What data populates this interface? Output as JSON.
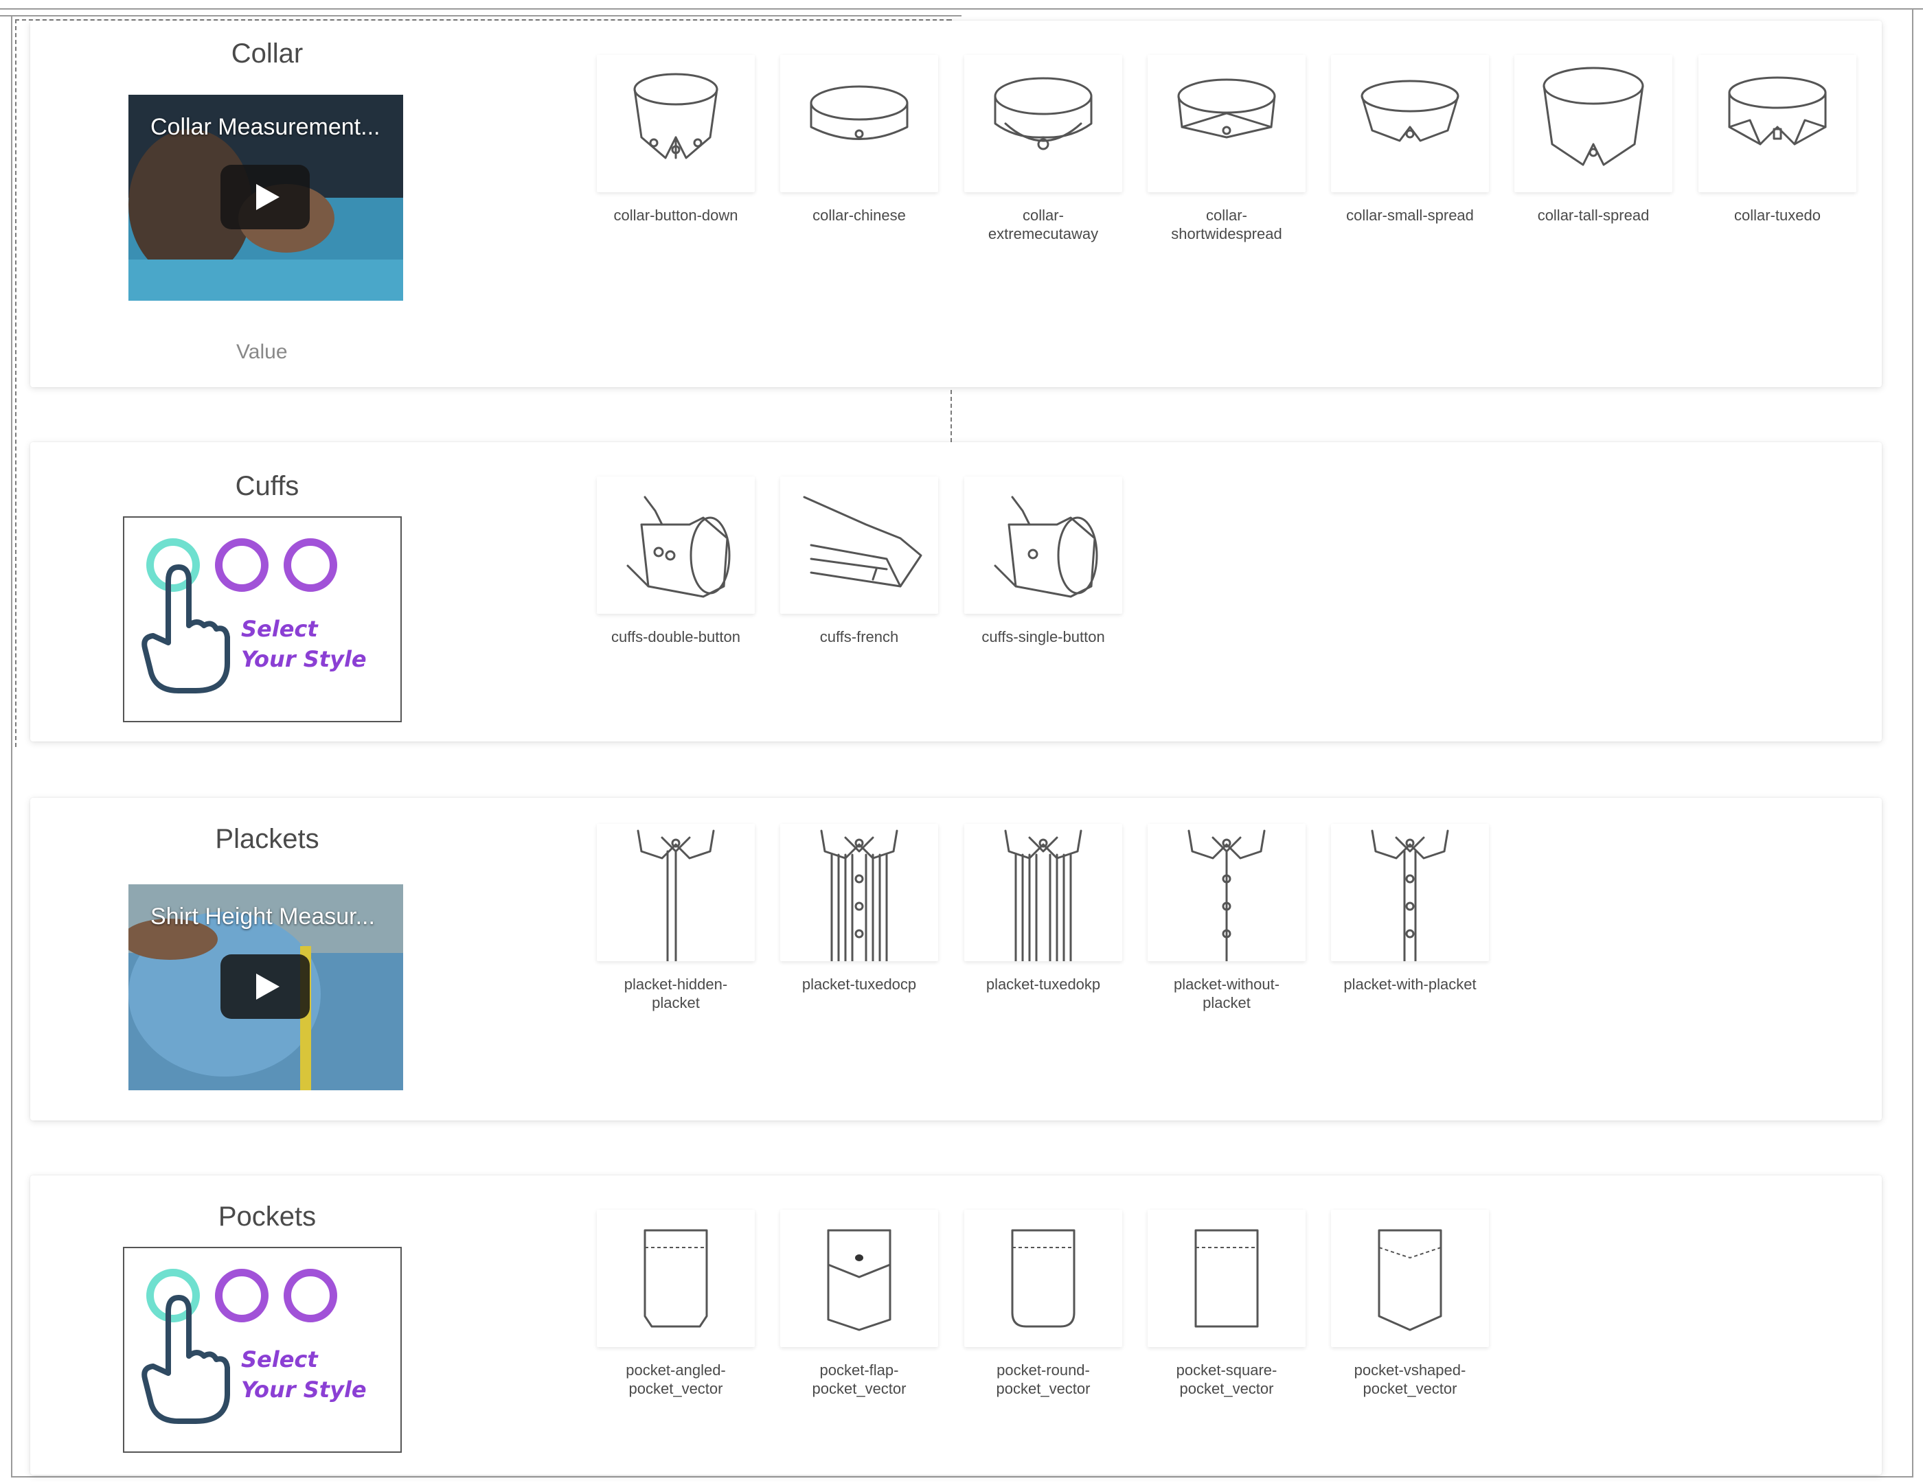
{
  "colors": {
    "panel_bg": "#ffffff",
    "title_text": "#4a4a4a",
    "ring_teal": "#6fe0cf",
    "ring_purple": "#a152d8",
    "select_text": "#8b3fd4",
    "line_art": "#555555"
  },
  "collar": {
    "title": "Collar",
    "video_title": "Collar Measurement...",
    "value_label": "Value",
    "options": [
      {
        "label": "collar-button-down",
        "icon": "collar-button-down-icon"
      },
      {
        "label": "collar-chinese",
        "icon": "collar-chinese-icon"
      },
      {
        "label": "collar-\nextremecutaway",
        "icon": "collar-extremecutaway-icon"
      },
      {
        "label": "collar-\nshortwidespread",
        "icon": "collar-shortwidespread-icon"
      },
      {
        "label": "collar-small-spread",
        "icon": "collar-small-spread-icon"
      },
      {
        "label": "collar-tall-spread",
        "icon": "collar-tall-spread-icon"
      },
      {
        "label": "collar-tuxedo",
        "icon": "collar-tuxedo-icon"
      }
    ]
  },
  "cuffs": {
    "title": "Cuffs",
    "select_line1": "Select",
    "select_line2": "Your Style",
    "options": [
      {
        "label": "cuffs-double-button",
        "icon": "cuff-double-button-icon"
      },
      {
        "label": "cuffs-french",
        "icon": "cuff-french-icon"
      },
      {
        "label": "cuffs-single-button",
        "icon": "cuff-single-button-icon"
      }
    ]
  },
  "plackets": {
    "title": "Plackets",
    "video_title": "Shirt Height Measur...",
    "options": [
      {
        "label": "placket-hidden-\nplacket",
        "icon": "placket-hidden-icon"
      },
      {
        "label": "placket-tuxedocp",
        "icon": "placket-tuxedocp-icon"
      },
      {
        "label": "placket-tuxedokp",
        "icon": "placket-tuxedokp-icon"
      },
      {
        "label": "placket-without-\nplacket",
        "icon": "placket-without-icon"
      },
      {
        "label": "placket-with-placket",
        "icon": "placket-with-icon"
      }
    ]
  },
  "pockets": {
    "title": "Pockets",
    "select_line1": "Select",
    "select_line2": "Your Style",
    "options": [
      {
        "label": "pocket-angled-\npocket_vector",
        "icon": "pocket-angled-icon"
      },
      {
        "label": "pocket-flap-\npocket_vector",
        "icon": "pocket-flap-icon"
      },
      {
        "label": "pocket-round-\npocket_vector",
        "icon": "pocket-round-icon"
      },
      {
        "label": "pocket-square-\npocket_vector",
        "icon": "pocket-square-icon"
      },
      {
        "label": "pocket-vshaped-\npocket_vector",
        "icon": "pocket-vshaped-icon"
      }
    ]
  }
}
